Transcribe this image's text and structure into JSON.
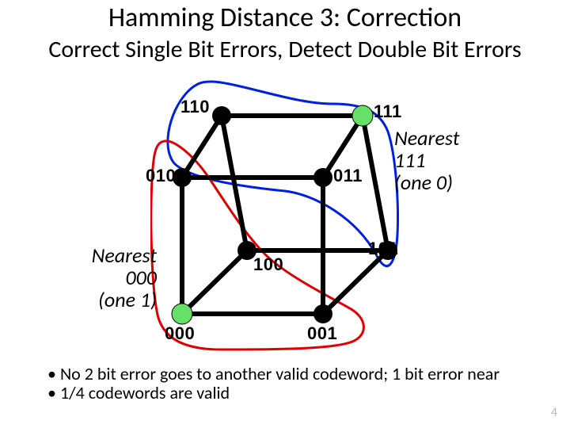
{
  "title": "Hamming Distance 3: Correction",
  "subtitle": "Correct Single Bit Errors, Detect Double Bit Errors",
  "annotations": {
    "right_line1": "Nearest",
    "right_line2": "111",
    "right_line3": "(one 0)",
    "left_line1": "Nearest",
    "left_line2": "000",
    "left_line3": "(one 1)"
  },
  "bullets": {
    "b1": "No 2 bit error goes to another valid codeword; 1 bit error near",
    "b2": "1/4 codewords are valid"
  },
  "labels": {
    "n110": "110",
    "n111": "111",
    "n010": "010",
    "n011": "011",
    "n100": "100",
    "n101": "101",
    "n000": "000",
    "n001": "001"
  },
  "page": "4",
  "chart_data": {
    "type": "diagram",
    "description": "3-bit binary cube (Hamming cube) with vertices labeled 000..111. Two regions drawn: red region around codeword 000 and its 1-bit neighbors (100,010,001); blue region around codeword 111 and its 1-bit neighbors (110,101,011). Valid codewords 000 and 111 are highlighted green.",
    "vertices": [
      "000",
      "001",
      "010",
      "011",
      "100",
      "101",
      "110",
      "111"
    ],
    "edges": [
      [
        "000",
        "001"
      ],
      [
        "000",
        "010"
      ],
      [
        "000",
        "100"
      ],
      [
        "001",
        "011"
      ],
      [
        "001",
        "101"
      ],
      [
        "010",
        "011"
      ],
      [
        "010",
        "110"
      ],
      [
        "011",
        "111"
      ],
      [
        "100",
        "101"
      ],
      [
        "100",
        "110"
      ],
      [
        "101",
        "111"
      ],
      [
        "110",
        "111"
      ]
    ],
    "valid_codewords": [
      "000",
      "111"
    ],
    "groups": {
      "nearest_000": [
        "000",
        "001",
        "010",
        "100"
      ],
      "nearest_111": [
        "111",
        "110",
        "101",
        "011"
      ]
    }
  }
}
